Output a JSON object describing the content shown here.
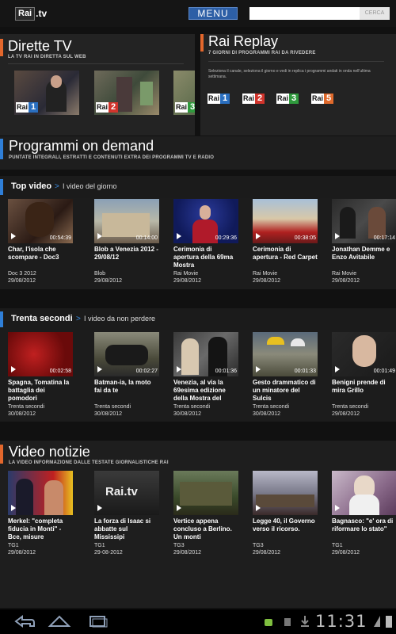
{
  "header": {
    "logo_rai": "Rai",
    "logo_tv": ".tv",
    "menu_label": "MENU",
    "search_placeholder": "",
    "search_button": "CERCA"
  },
  "dirette": {
    "title": "Dirette TV",
    "subtitle": "LA TV RAI IN DIRETTA SUL WEB",
    "channels": [
      {
        "rai": "Rai",
        "num": "1",
        "color": "#2a6fc0"
      },
      {
        "rai": "Rai",
        "num": "2",
        "color": "#d2342c"
      },
      {
        "rai": "Rai",
        "num": "3",
        "color": "#2f9a3d"
      }
    ]
  },
  "replay": {
    "title": "Rai Replay",
    "subtitle": "7 GIORNI DI PROGRAMMI RAI DA RIVEDERE",
    "description": "Seleziona il canale, seleziona il giorno e vedi in replica i programmi andati in onda nell'ultima settimana.",
    "channels": [
      {
        "rai": "Rai",
        "num": "1",
        "color": "#2a6fc0"
      },
      {
        "rai": "Rai",
        "num": "2",
        "color": "#d2342c"
      },
      {
        "rai": "Rai",
        "num": "3",
        "color": "#2f9a3d"
      },
      {
        "rai": "Rai",
        "num": "5",
        "color": "#e06a2c"
      }
    ]
  },
  "ondemand": {
    "title": "Programmi on demand",
    "subtitle": "PUNTATE INTEGRALI, ESTRATTI E CONTENUTI EXTRA DEI PROGRAMMI TV E RADIO"
  },
  "top_video": {
    "title": "Top video",
    "desc": "I video del giorno",
    "items": [
      {
        "title": "Char, l'isola che scompare - Doc3",
        "duration": "00:54:39",
        "source": "Doc 3 2012",
        "date": "29/08/2012"
      },
      {
        "title": "Blob a Venezia 2012 - 29/08/12",
        "duration": "00:14:00",
        "source": "Blob",
        "date": "29/08/2012"
      },
      {
        "title": "Cerimonia di apertura della 69ma Mostra",
        "duration": "00:29:36",
        "source": "Rai Movie",
        "date": "29/08/2012"
      },
      {
        "title": "Cerimonia di apertura - Red Carpet",
        "duration": "00:38:05",
        "source": "Rai Movie",
        "date": "29/08/2012"
      },
      {
        "title": "Jonathan Demme e Enzo Avitabile",
        "duration": "00:17:14",
        "source": "Rai Movie",
        "date": "29/08/2012"
      }
    ]
  },
  "trenta": {
    "title": "Trenta secondi",
    "desc": "I video da non perdere",
    "items": [
      {
        "title": "Spagna, Tomatina la battaglia dei pomodori",
        "duration": "00:02:58",
        "source": "Trenta secondi",
        "date": "30/08/2012"
      },
      {
        "title": "Batman-ia, la moto fai da te",
        "duration": "00:02:27",
        "source": "Trenta secondi",
        "date": "30/08/2012"
      },
      {
        "title": "Venezia, al via la 69esima edizione della Mostra del",
        "duration": "00:01:36",
        "source": "Trenta secondi",
        "date": "30/08/2012"
      },
      {
        "title": "Gesto drammatico di un minatore del Sulcis",
        "duration": "00:01:33",
        "source": "Trenta secondi",
        "date": "30/08/2012"
      },
      {
        "title": "Benigni prende di mira Grillo",
        "duration": "00:01:49",
        "source": "Trenta secondi",
        "date": "29/08/2012"
      }
    ]
  },
  "notizie": {
    "title": "Video notizie",
    "subtitle": "LA VIDEO INFORMAZIONE DALLE TESTATE GIORNALISTICHE RAI",
    "items": [
      {
        "title": "Merkel: \"completa fiducia in Monti\" - Bce, misure eccezionali",
        "source": "TG1",
        "date": "29/08/2012"
      },
      {
        "title": "La forza di Isaac si abbatte sul Mississipi",
        "source": "TG1",
        "date": "29-08-2012"
      },
      {
        "title": "Vertice appena concluso a Berlino. Un monti",
        "source": "TG3",
        "date": "29/08/2012"
      },
      {
        "title": "Legge 40, il Governo verso il ricorso.",
        "source": "TG3",
        "date": "29/08/2012"
      },
      {
        "title": "Bagnasco: \"e' ora di riformare lo stato\"",
        "source": "TG1",
        "date": "29/08/2012"
      }
    ]
  },
  "status": {
    "clock": "11:31"
  }
}
